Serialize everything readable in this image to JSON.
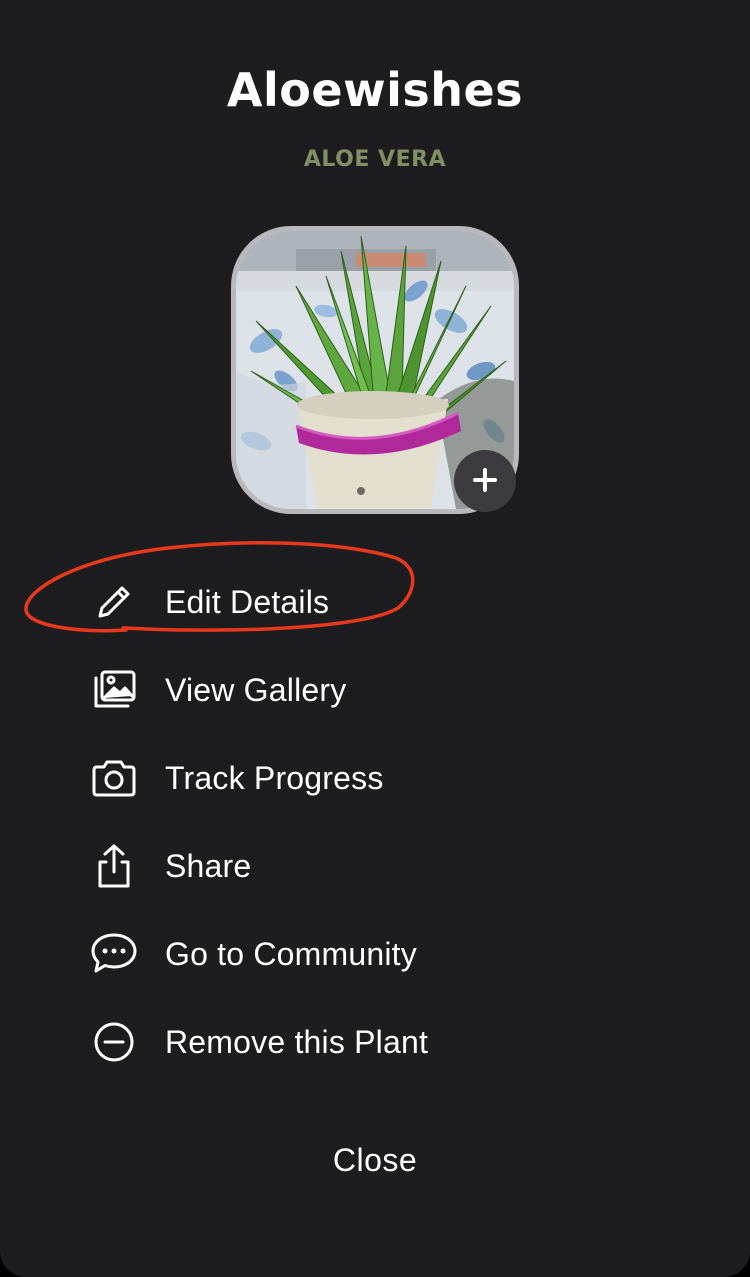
{
  "plant": {
    "name": "Aloewishes",
    "species": "ALOE VERA"
  },
  "photo": {
    "add_icon": "plus-icon"
  },
  "menu": {
    "items": [
      {
        "label": "Edit Details",
        "icon": "pencil-icon"
      },
      {
        "label": "View Gallery",
        "icon": "gallery-icon"
      },
      {
        "label": "Track Progress",
        "icon": "camera-icon"
      },
      {
        "label": "Share",
        "icon": "share-icon"
      },
      {
        "label": "Go to Community",
        "icon": "chat-bubble-icon"
      },
      {
        "label": "Remove this Plant",
        "icon": "minus-circle-icon"
      }
    ]
  },
  "actions": {
    "close_label": "Close"
  },
  "colors": {
    "background": "#1d1d1f",
    "species_text": "#7f9164",
    "annotation": "#e8391e"
  }
}
